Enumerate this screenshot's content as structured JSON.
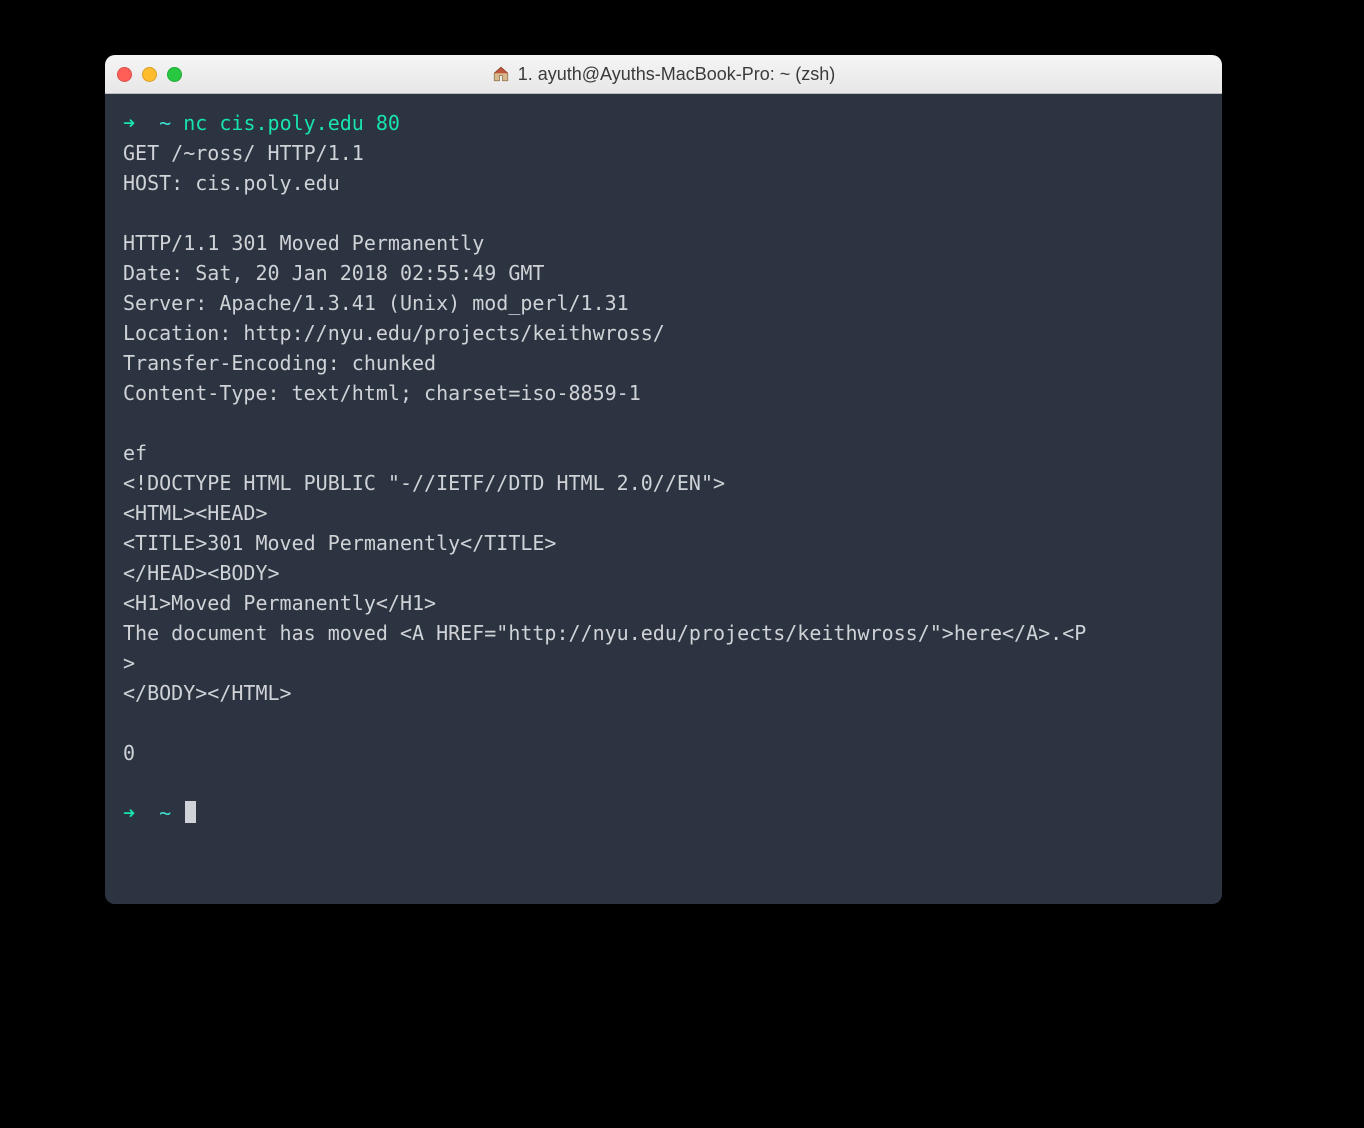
{
  "window": {
    "title": "1. ayuth@Ayuths-MacBook-Pro: ~ (zsh)",
    "icon": "home-icon"
  },
  "colors": {
    "prompt_arrow": "#18e3b0",
    "prompt_tilde": "#3fe0cf",
    "term_bg": "#2b3440",
    "term_fg": "#cfd2d6"
  },
  "terminal": {
    "prompt_arrow": "➜",
    "prompt_path": "~",
    "command": "nc cis.poly.edu 80",
    "lines": [
      "GET /~ross/ HTTP/1.1",
      "HOST: cis.poly.edu",
      "",
      "HTTP/1.1 301 Moved Permanently",
      "Date: Sat, 20 Jan 2018 02:55:49 GMT",
      "Server: Apache/1.3.41 (Unix) mod_perl/1.31",
      "Location: http://nyu.edu/projects/keithwross/",
      "Transfer-Encoding: chunked",
      "Content-Type: text/html; charset=iso-8859-1",
      "",
      "ef",
      "<!DOCTYPE HTML PUBLIC \"-//IETF//DTD HTML 2.0//EN\">",
      "<HTML><HEAD>",
      "<TITLE>301 Moved Permanently</TITLE>",
      "</HEAD><BODY>",
      "<H1>Moved Permanently</H1>",
      "The document has moved <A HREF=\"http://nyu.edu/projects/keithwross/\">here</A>.<P",
      ">",
      "</BODY></HTML>",
      "",
      "0",
      ""
    ],
    "second_prompt_arrow": "➜",
    "second_prompt_path": "~"
  }
}
